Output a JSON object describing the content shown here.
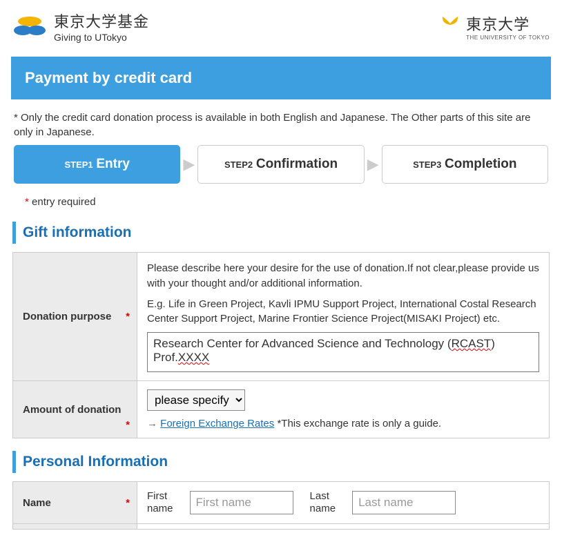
{
  "header": {
    "logo_jp": "東京大学基金",
    "logo_en": "Giving to UTokyo",
    "right_jp": "東京大学",
    "right_en": "THE UNIVERSITY OF TOKYO"
  },
  "page_title": "Payment by credit card",
  "note": "* Only the credit card donation process is available in both English and Japanese.   The Other parts of this site are only in Japanese.",
  "steps": {
    "s1_small": "STEP1",
    "s1_big": "Entry",
    "s2_small": "STEP2",
    "s2_big": "Confirmation",
    "s3_small": "STEP3",
    "s3_big": "Completion"
  },
  "entry_required": " entry required",
  "sections": {
    "gift": "Gift information",
    "personal": "Personal Information"
  },
  "gift": {
    "purpose_label": "Donation purpose",
    "purpose_help1": "Please describe here your desire for the use of donation.If not clear,please provide us with your thought and/or additional information.",
    "purpose_help2": "E.g. Life in Green Project, Kavli IPMU Support Project, International Costal Research Center Support Project, Marine Frontier Science Project(MISAKI Project) etc.",
    "purpose_value_line1a": "Research Center for Advanced Science and Technology (",
    "purpose_value_rcast": "RCAST",
    "purpose_value_line1b": ")",
    "purpose_value_line2a": "Prof.",
    "purpose_value_xxxx": "XXXX",
    "amount_label": "Amount of donation",
    "amount_selected": "please specify",
    "exchange_arrow": "→",
    "exchange_link": "Foreign Exchange Rates",
    "exchange_note": "   *This exchange rate is only a guide."
  },
  "personal": {
    "name_label": "Name",
    "first_label": "First\nname",
    "first_placeholder": "First name",
    "last_label": "Last\nname",
    "last_placeholder": "Last name"
  }
}
